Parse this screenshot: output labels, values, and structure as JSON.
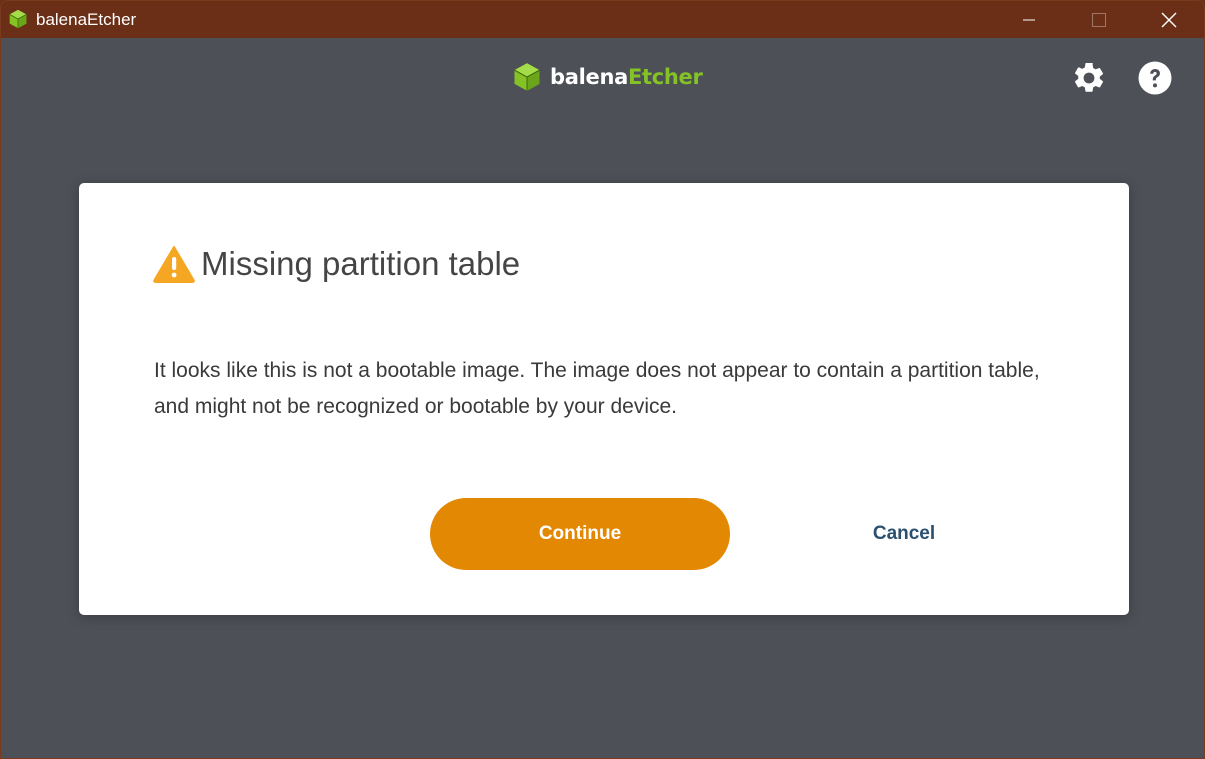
{
  "window": {
    "title": "balenaEtcher",
    "controls": {
      "minimize_icon": "minimize-icon",
      "maximize_icon": "maximize-icon",
      "close_icon": "close-icon"
    }
  },
  "header": {
    "logo": {
      "part1": "balena",
      "part2": "Etcher"
    },
    "settings_icon": "gear-icon",
    "help_icon": "question-circle-icon"
  },
  "modal": {
    "title": "Missing partition table",
    "icon": "warning-icon",
    "body": "It looks like this is not a bootable image. The image does not appear to contain a partition table, and might not be recognized or bootable by your device.",
    "continue_label": "Continue",
    "cancel_label": "Cancel"
  },
  "colors": {
    "titlebar": "#6b2e16",
    "background": "#4d5057",
    "accent_orange": "#e38803",
    "brand_green": "#85c226",
    "cancel_text": "#2a506f"
  }
}
